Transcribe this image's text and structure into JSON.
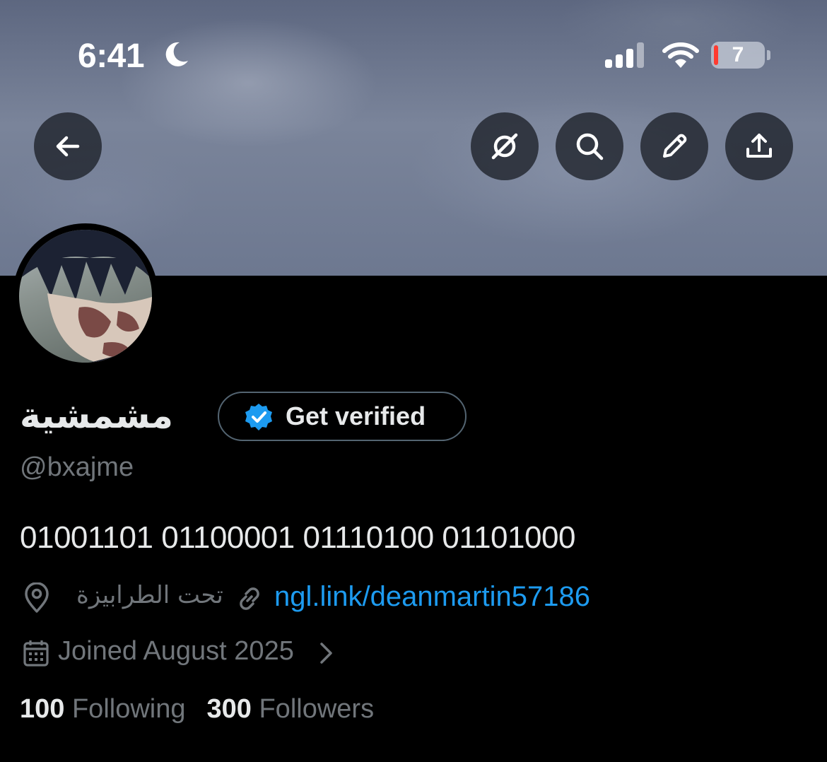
{
  "status_bar": {
    "time": "6:41",
    "battery_level": "7",
    "icons": [
      "moon-icon",
      "cellular-signal-icon",
      "wifi-icon",
      "battery-icon"
    ]
  },
  "header": {
    "buttons": [
      {
        "name": "back-button",
        "icon": "arrow-left-icon"
      },
      {
        "name": "grok-button",
        "icon": "grok-icon"
      },
      {
        "name": "search-button",
        "icon": "search-icon"
      },
      {
        "name": "edit-button",
        "icon": "pencil-icon"
      },
      {
        "name": "share-button",
        "icon": "share-upload-icon"
      }
    ]
  },
  "profile": {
    "display_name": "مشمشية",
    "verify_label": "Get verified",
    "handle": "@bxajme",
    "bio": "01001101 01100001 01110100 01101000",
    "location": "تحت الطرابيزة",
    "link": "ngl.link/deanmartin57186",
    "joined": "Joined August 2025",
    "following_count": "100",
    "following_label": "Following",
    "followers_count": "300",
    "followers_label": "Followers"
  },
  "colors": {
    "background": "#000000",
    "primary_text": "#e7e9ea",
    "secondary_text": "#71767b",
    "link": "#1d9bf0",
    "verified_badge": "#1d9bf0",
    "button_border": "#536471"
  }
}
